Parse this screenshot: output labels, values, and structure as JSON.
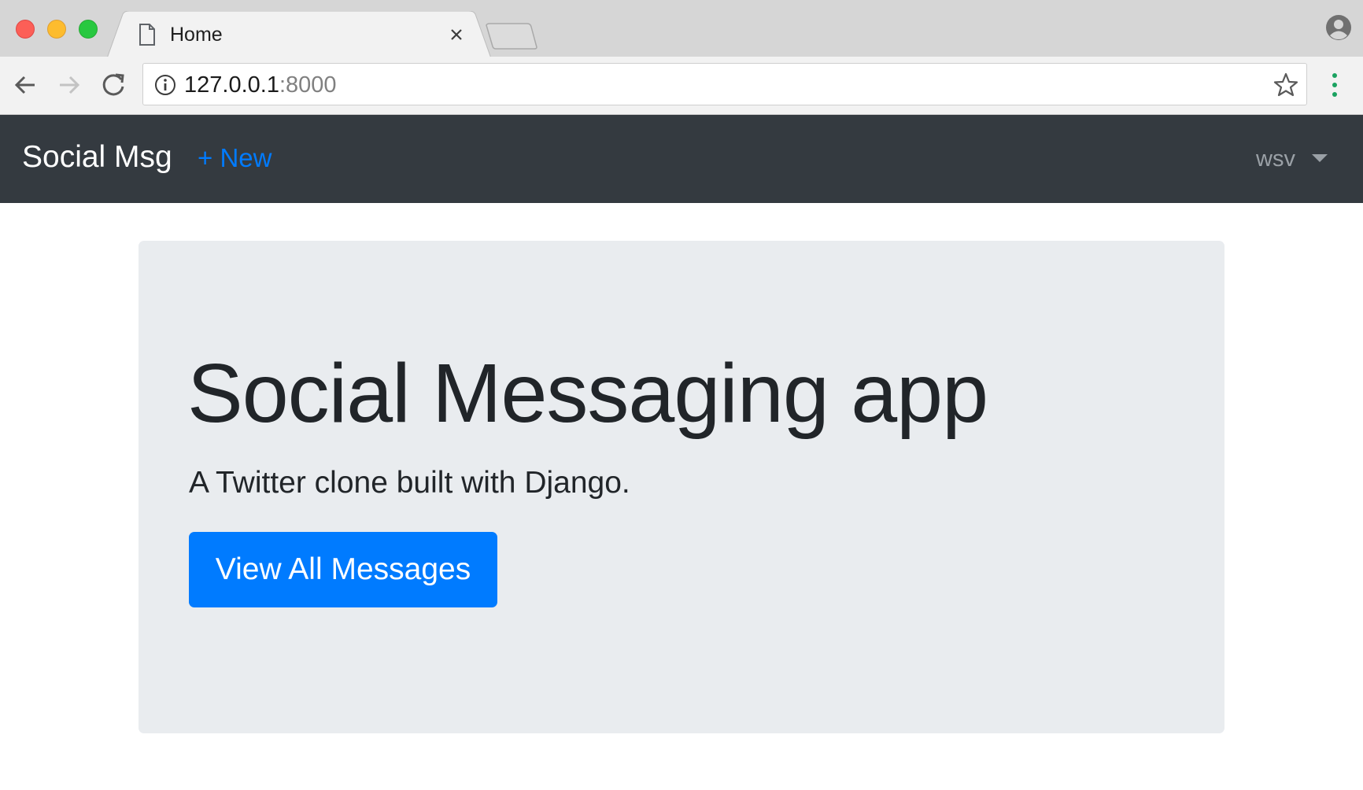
{
  "browser": {
    "tab": {
      "title": "Home"
    },
    "address": {
      "host": "127.0.0.1",
      "port": ":8000"
    }
  },
  "navbar": {
    "brand": "Social Msg",
    "new_link": "+ New",
    "user": "wsv"
  },
  "jumbotron": {
    "title": "Social Messaging app",
    "lead": "A Twitter clone built with Django.",
    "button_label": "View All Messages"
  },
  "colors": {
    "navbar_bg": "#343a40",
    "jumbotron_bg": "#e9ecef",
    "primary": "#007bff"
  },
  "icons": [
    "page-icon",
    "close-icon",
    "profile-icon",
    "back-icon",
    "forward-icon",
    "reload-icon",
    "info-icon",
    "star-icon",
    "menu-icon",
    "chevron-down-icon"
  ]
}
